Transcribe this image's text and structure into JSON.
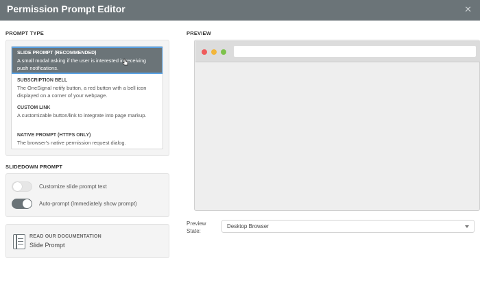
{
  "window": {
    "title": "Permission Prompt Editor",
    "close_glyph": "✕"
  },
  "prompt_type": {
    "heading": "PROMPT TYPE",
    "options": [
      {
        "name": "SLIDE PROMPT (RECOMMENDED)",
        "desc": "A small modal asking if the user is interested in receiving push notifications.",
        "selected": true
      },
      {
        "name": "SUBSCRIPTION BELL",
        "desc": "The OneSignal notify button, a red button with a bell icon displayed on a corner of your webpage.",
        "selected": false
      },
      {
        "name": "CUSTOM LINK",
        "desc": "A customizable button/link to integrate into page markup.",
        "selected": false
      },
      {
        "name": "NATIVE PROMPT (HTTPS ONLY)",
        "desc": "The browser's native permission request dialog.",
        "selected": false
      }
    ]
  },
  "slidedown": {
    "heading": "SLIDEDOWN PROMPT",
    "toggles": [
      {
        "label": "Customize slide prompt text",
        "on": false
      },
      {
        "label": "Auto-prompt (Immediately show prompt)",
        "on": true
      }
    ]
  },
  "docs": {
    "kicker": "READ OUR DOCUMENTATION",
    "link": "Slide Prompt",
    "icon": "book-icon"
  },
  "preview": {
    "heading": "PREVIEW",
    "state_label": "Preview State:",
    "state_value": "Desktop Browser",
    "dot_colors": [
      "#ef5b5b",
      "#f2b63b",
      "#7dc24b"
    ]
  },
  "colors": {
    "header": "#6b7478",
    "selection_outline": "#5aa3e6"
  }
}
